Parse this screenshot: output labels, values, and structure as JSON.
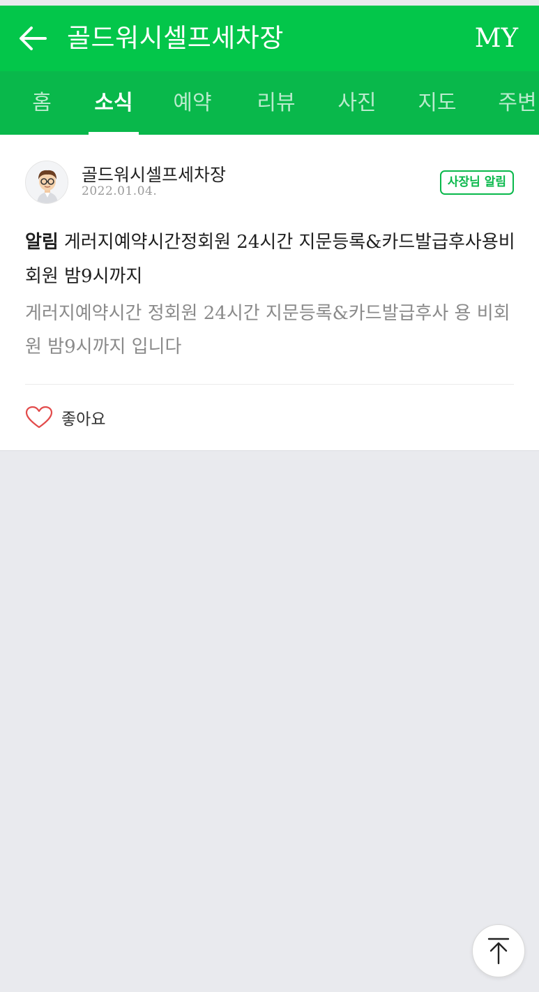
{
  "header": {
    "title": "골드워시셀프세차장",
    "my_label": "MY",
    "back_icon": "arrow-left-icon",
    "background": "#03c64a"
  },
  "tabs": {
    "background": "#09b84b",
    "items": [
      {
        "label": "홈",
        "active": false
      },
      {
        "label": "소식",
        "active": true
      },
      {
        "label": "예약",
        "active": false
      },
      {
        "label": "리뷰",
        "active": false
      },
      {
        "label": "사진",
        "active": false
      },
      {
        "label": "지도",
        "active": false
      },
      {
        "label": "주변",
        "active": false
      }
    ]
  },
  "post": {
    "author": "골드워시셀프세차장",
    "date": "2022.01.04.",
    "badge": "사장님 알림",
    "title_label": "알림",
    "title_text": "게러지예약시간정회원 24시간 지문등록&카드발급후사용비회원 밤9시까지",
    "body": "게러지예약시간 정회원 24시간 지문등록&카드발급후사 용 비회원 밤9시까지 입니다",
    "like_label": "좋아요",
    "like_icon": "heart-outline-icon"
  },
  "scroll_top_icon": "arrow-up-icon",
  "accent_color": "#09b84b",
  "like_color": "#e24b4b"
}
